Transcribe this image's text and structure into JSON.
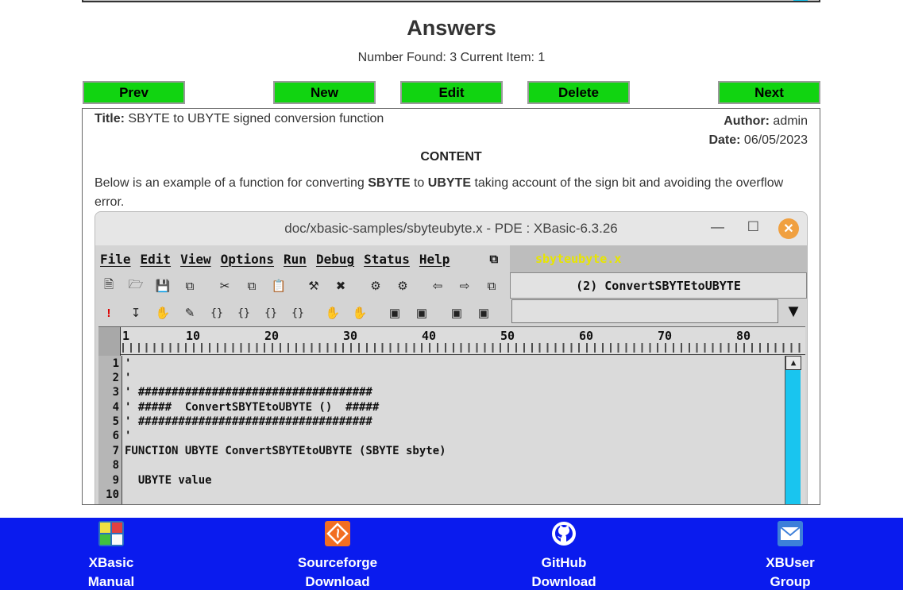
{
  "page": {
    "heading": "Answers",
    "status": "Number Found: 3 Current Item: 1"
  },
  "nav": {
    "prev": "Prev",
    "new": "New",
    "edit": "Edit",
    "delete": "Delete",
    "next": "Next"
  },
  "answer": {
    "title_label": "Title:",
    "title": "SBYTE to UBYTE signed conversion function",
    "author_label": "Author:",
    "author": "admin",
    "date_label": "Date:",
    "date": "06/05/2023",
    "content_heading": "CONTENT",
    "body_part1": "Below is an example of a function for converting ",
    "body_bold1": "SBYTE",
    "body_part2": " to ",
    "body_bold2": "UBYTE",
    "body_part3": " taking account of the sign bit and avoiding the overflow error."
  },
  "screenshot": {
    "window_title": "doc/xbasic-samples/sbyteubyte.x - PDE : XBasic-6.3.26",
    "menu": [
      "File",
      "Edit",
      "View",
      "Options",
      "Run",
      "Debug",
      "Status",
      "Help"
    ],
    "file_name": "sbyteubyte.x",
    "function_box": "(2) ConvertSBYTEtoUBYTE",
    "ruler_numbers": [
      "1",
      "10",
      "20",
      "30",
      "40",
      "50",
      "60",
      "70",
      "80"
    ],
    "line_numbers": [
      "1",
      "2",
      "3",
      "4",
      "5",
      "6",
      "7",
      "8",
      "9",
      "10"
    ],
    "code_lines": [
      "'",
      "'",
      "' ###################################",
      "' #####  ConvertSBYTEtoUBYTE ()  #####",
      "' ###################################",
      "'",
      "FUNCTION UBYTE ConvertSBYTEtoUBYTE (SBYTE sbyte)",
      "",
      "  UBYTE value",
      ""
    ]
  },
  "footer": {
    "manual_line1": "XBasic",
    "manual_line2": "Manual",
    "sourceforge_line1": "Sourceforge",
    "sourceforge_line2": "Download",
    "github_line1": "GitHub",
    "github_line2": "Download",
    "group_line1": "XBUser",
    "group_line2": "Group"
  },
  "colors": {
    "button_green": "#11d411",
    "footer_blue": "#0a1bee",
    "scroll_cyan": "#19c5ef",
    "filename_yellow": "#e7e500"
  }
}
